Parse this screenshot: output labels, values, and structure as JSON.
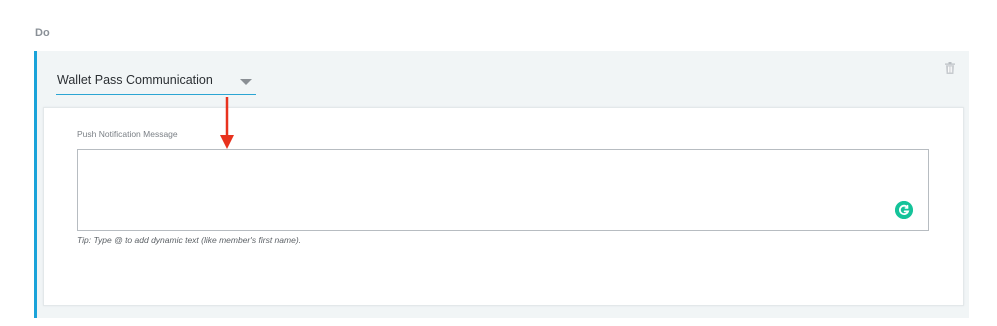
{
  "section": {
    "label": "Do"
  },
  "action": {
    "selected_type": "Wallet Pass Communication",
    "caret_icon": "chevron-down-icon",
    "delete_icon": "trash-icon"
  },
  "message_field": {
    "label": "Push Notification Message",
    "value": "",
    "tip": "Tip: Type @ to add dynamic text (like member's first name).",
    "assistant_icon": "grammarly-icon"
  },
  "colors": {
    "accent": "#1aa3d9",
    "card_bg": "#f1f5f6",
    "annotation_arrow": "#e8321e",
    "grammarly_green": "#15c39a"
  }
}
